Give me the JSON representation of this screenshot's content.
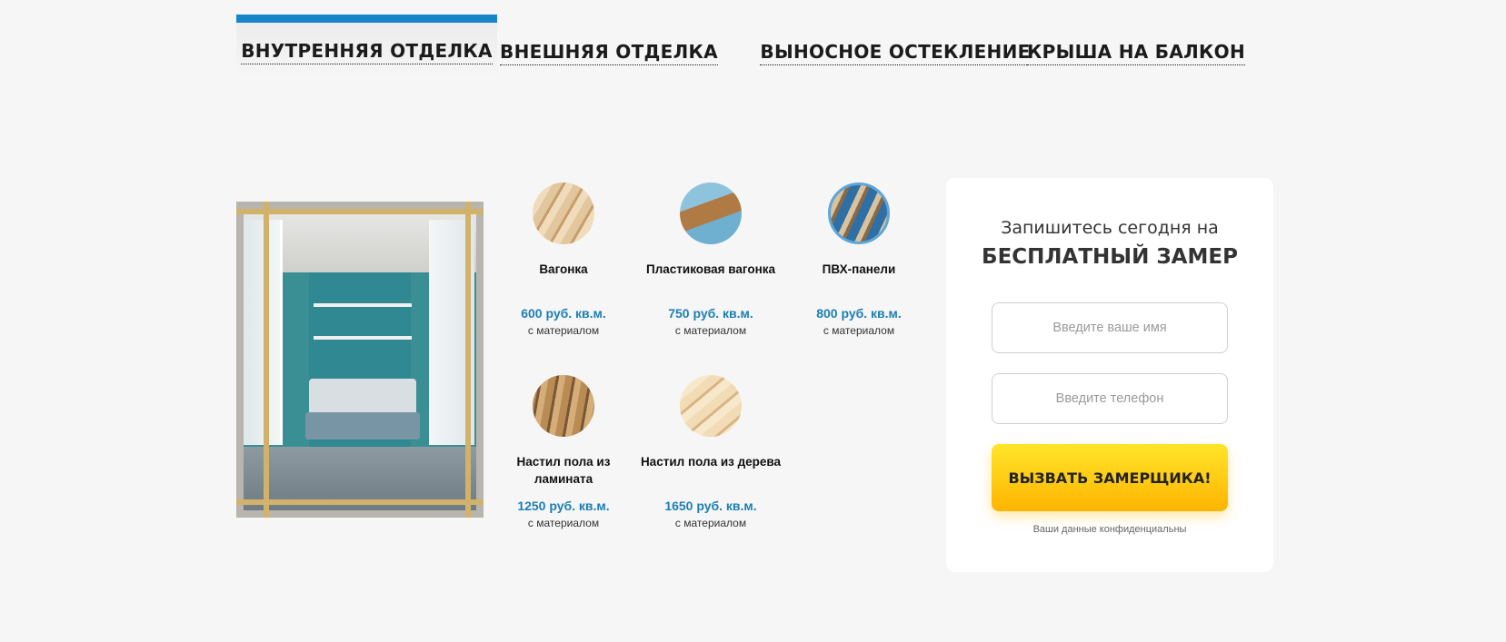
{
  "tabs": [
    {
      "label": "ВНУТРЕННЯЯ ОТДЕЛКА",
      "active": true
    },
    {
      "label": "ВНЕШНЯЯ ОТДЕЛКА",
      "active": false
    },
    {
      "label": "ВЫНОСНОЕ ОСТЕКЛЕНИЕ",
      "active": false
    },
    {
      "label": "КРЫША НА БАЛКОН",
      "active": false
    }
  ],
  "accent_color": "#1586c8",
  "products": [
    {
      "name": "Вагонка",
      "price": "600 руб. кв.м.",
      "note": "с материалом",
      "icon": "wood-lining-image"
    },
    {
      "name": "Пластиковая вагонка",
      "price": "750 руб. кв.м.",
      "note": "с материалом",
      "icon": "plastic-lining-image"
    },
    {
      "name": "ПВХ-панели",
      "price": "800 руб. кв.м.",
      "note": "с материалом",
      "icon": "pvc-panels-image"
    },
    {
      "name": "Настил пола из ламината",
      "price": "1250 руб. кв.м.",
      "note": "с материалом",
      "icon": "laminate-floor-image"
    },
    {
      "name": "Настил пола из дерева",
      "price": "1650 руб. кв.м.",
      "note": "с материалом",
      "icon": "wood-floor-image"
    }
  ],
  "form": {
    "subtitle": "Запишитесь сегодня на",
    "title": "БЕСПЛАТНЫЙ ЗАМЕР",
    "name_placeholder": "Введите ваше имя",
    "phone_placeholder": "Введите телефон",
    "button_label": "ВЫЗВАТЬ ЗАМЕРЩИКА!",
    "privacy_note": "Ваши данные конфиденциальны"
  }
}
